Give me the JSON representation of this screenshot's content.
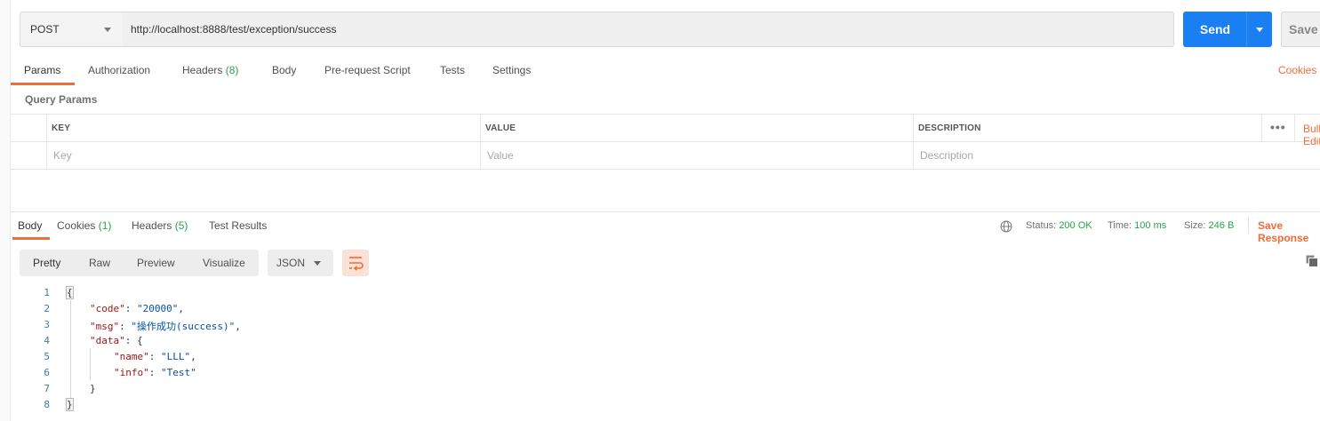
{
  "request": {
    "method": "POST",
    "url": "http://localhost:8888/test/exception/success",
    "send_label": "Send",
    "save_label": "Save"
  },
  "request_tabs": [
    {
      "label": "Params",
      "active": true
    },
    {
      "label": "Authorization"
    },
    {
      "label": "Headers",
      "count": "(8)"
    },
    {
      "label": "Body"
    },
    {
      "label": "Pre-request Script"
    },
    {
      "label": "Tests"
    },
    {
      "label": "Settings"
    }
  ],
  "cookies_link": "Cookies",
  "query_params": {
    "title": "Query Params",
    "columns": [
      "KEY",
      "VALUE",
      "DESCRIPTION"
    ],
    "placeholders": [
      "Key",
      "Value",
      "Description"
    ],
    "more_label": "•••",
    "bulk_label": "Bulk Edit"
  },
  "response_tabs": [
    {
      "label": "Body",
      "active": true
    },
    {
      "label": "Cookies",
      "count": "(1)"
    },
    {
      "label": "Headers",
      "count": "(5)"
    },
    {
      "label": "Test Results"
    }
  ],
  "status": {
    "status_label": "Status:",
    "status_value": "200 OK",
    "time_label": "Time:",
    "time_value": "100 ms",
    "size_label": "Size:",
    "size_value": "246 B",
    "save_response": "Save Response"
  },
  "format": {
    "modes": [
      "Pretty",
      "Raw",
      "Preview",
      "Visualize"
    ],
    "active_mode": "Pretty",
    "language": "JSON"
  },
  "code": {
    "line_numbers": [
      "1",
      "2",
      "3",
      "4",
      "5",
      "6",
      "7",
      "8"
    ],
    "open_brace": "{",
    "close_brace": "}",
    "code_key": "\"code\"",
    "code_val": "\"20000\"",
    "msg_key": "\"msg\"",
    "msg_val": "\"操作成功(success)\"",
    "data_key": "\"data\"",
    "name_key": "\"name\"",
    "name_val": "\"LLL\"",
    "info_key": "\"info\"",
    "info_val": "\"Test\""
  },
  "colors": {
    "accent": "#f26b3a",
    "send_blue": "#1a7ff2",
    "status_green": "#27a34a"
  }
}
